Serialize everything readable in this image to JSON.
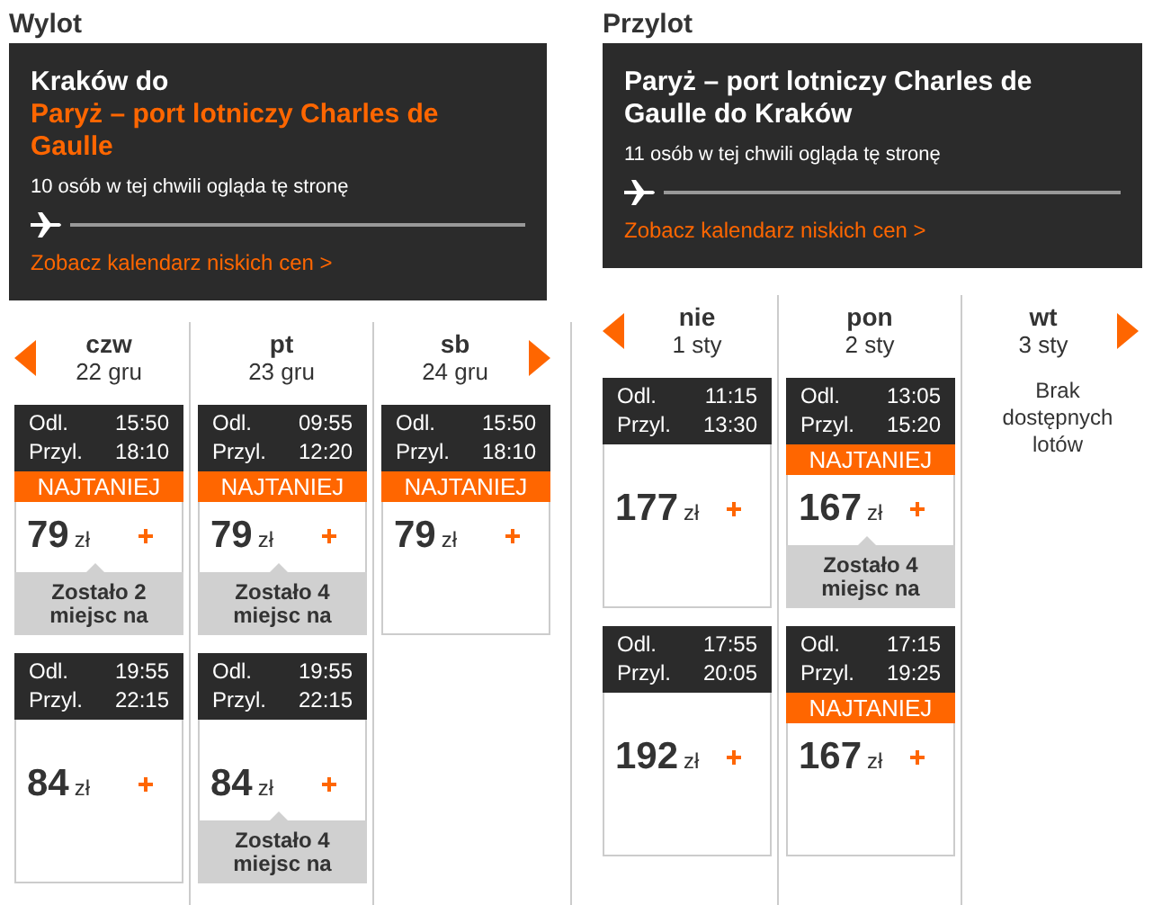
{
  "sections": [
    {
      "title": "Wylot",
      "route": [
        {
          "text": "Kraków do",
          "highlight": false
        },
        {
          "text": "Paryż – port lotniczy Charles de Gaulle",
          "highlight": true
        }
      ],
      "viewers": "10 osób w tej chwili ogląda tę stronę",
      "calendar_link": "Zobacz kalendarz niskich cen >",
      "days": [
        {
          "weekday": "czw",
          "date": "22 gru",
          "flights": [
            {
              "dep_label": "Odl.",
              "dep": "15:50",
              "arr_label": "Przyl.",
              "arr": "18:10",
              "badge": "NAJTANIEJ",
              "price": "79",
              "currency": "zł",
              "seats_note": "Zostało 2 miejsc na"
            },
            {
              "dep_label": "Odl.",
              "dep": "19:55",
              "arr_label": "Przyl.",
              "arr": "22:15",
              "price": "84",
              "currency": "zł"
            }
          ]
        },
        {
          "weekday": "pt",
          "date": "23 gru",
          "flights": [
            {
              "dep_label": "Odl.",
              "dep": "09:55",
              "arr_label": "Przyl.",
              "arr": "12:20",
              "badge": "NAJTANIEJ",
              "price": "79",
              "currency": "zł",
              "seats_note": "Zostało 4 miejsc na"
            },
            {
              "dep_label": "Odl.",
              "dep": "19:55",
              "arr_label": "Przyl.",
              "arr": "22:15",
              "price": "84",
              "currency": "zł",
              "seats_note": "Zostało 4 miejsc na"
            }
          ]
        },
        {
          "weekday": "sb",
          "date": "24 gru",
          "flights": [
            {
              "dep_label": "Odl.",
              "dep": "15:50",
              "arr_label": "Przyl.",
              "arr": "18:10",
              "badge": "NAJTANIEJ",
              "price": "79",
              "currency": "zł"
            }
          ]
        }
      ]
    },
    {
      "title": "Przylot",
      "route": [
        {
          "text": "Paryż – port lotniczy Charles de Gaulle do Kraków",
          "highlight": false
        }
      ],
      "viewers": "11 osób w tej chwili ogląda tę stronę",
      "calendar_link": "Zobacz kalendarz niskich cen >",
      "days": [
        {
          "weekday": "nie",
          "date": "1 sty",
          "flights": [
            {
              "dep_label": "Odl.",
              "dep": "11:15",
              "arr_label": "Przyl.",
              "arr": "13:30",
              "price": "177",
              "currency": "zł"
            },
            {
              "dep_label": "Odl.",
              "dep": "17:55",
              "arr_label": "Przyl.",
              "arr": "20:05",
              "price": "192",
              "currency": "zł"
            }
          ]
        },
        {
          "weekday": "pon",
          "date": "2 sty",
          "flights": [
            {
              "dep_label": "Odl.",
              "dep": "13:05",
              "arr_label": "Przyl.",
              "arr": "15:20",
              "badge": "NAJTANIEJ",
              "price": "167",
              "currency": "zł",
              "seats_note": "Zostało 4 miejsc na"
            },
            {
              "dep_label": "Odl.",
              "dep": "17:15",
              "arr_label": "Przyl.",
              "arr": "19:25",
              "badge": "NAJTANIEJ",
              "price": "167",
              "currency": "zł"
            }
          ]
        },
        {
          "weekday": "wt",
          "date": "3 sty",
          "empty_note": "Brak dostępnych lotów"
        }
      ]
    }
  ]
}
